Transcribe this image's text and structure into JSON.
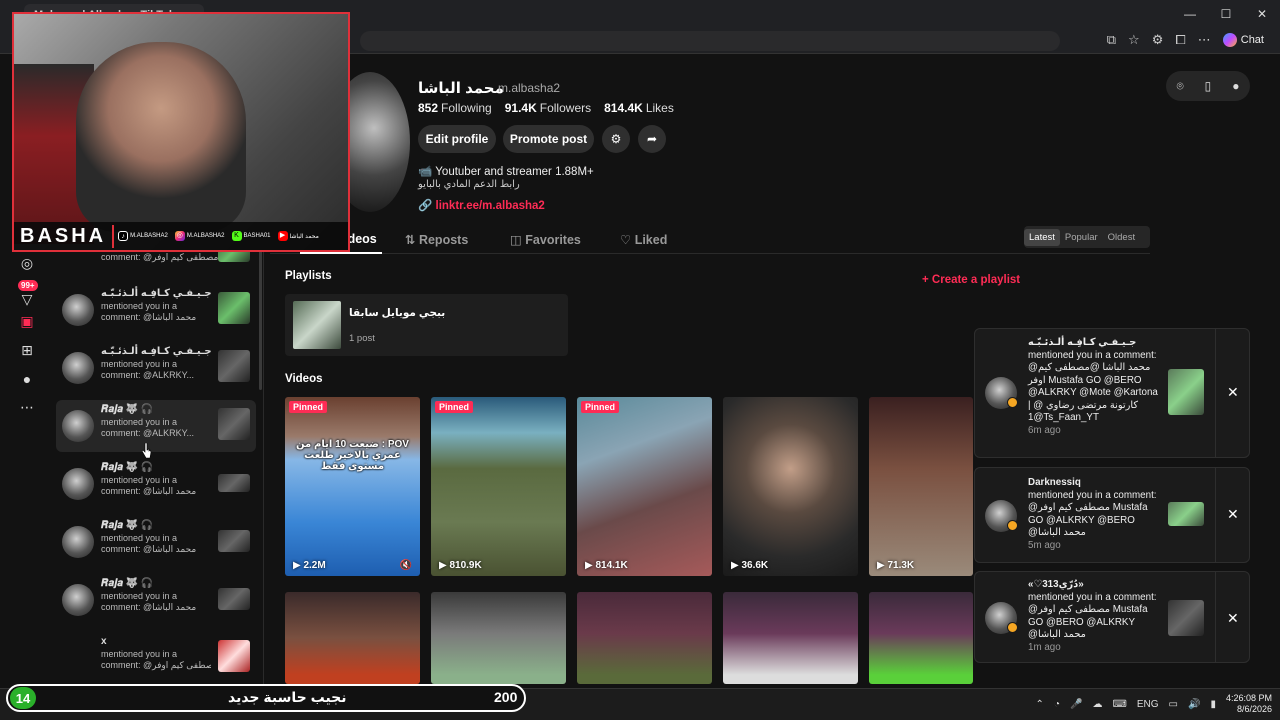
{
  "browser": {
    "tab_title": "Mohamed Albasha · TikTok",
    "chat_label": "Chat"
  },
  "profile": {
    "display_name": "محمد الباشا",
    "username": "m.albasha2",
    "following_count": "852",
    "following_label": "Following",
    "followers_count": "91.4K",
    "followers_label": "Followers",
    "likes_count": "814.4K",
    "likes_label": "Likes",
    "edit_label": "Edit profile",
    "promote_label": "Promote post",
    "bio_line1": "📹 Youtuber and streamer 1.88M+",
    "bio_line2": "رابط الدعم المادي بالبايو",
    "link": "linktr.ee/m.albasha2"
  },
  "tabs": {
    "videos": "Videos",
    "reposts": "Reposts",
    "favorites": "Favorites",
    "liked": "Liked"
  },
  "sort": {
    "latest": "Latest",
    "popular": "Popular",
    "oldest": "Oldest"
  },
  "playlists": {
    "heading": "Playlists",
    "create_label": "+ Create a playlist",
    "item_title": "ببجي موبايل سابقا",
    "item_count": "1 post"
  },
  "videos_heading": "Videos",
  "videos": [
    {
      "pinned": "Pinned",
      "views": "▶ 2.2M",
      "caption": "POV : ضيعت 10 ايام من عمري بالاخير طلعت مستوى فقط"
    },
    {
      "pinned": "Pinned",
      "views": "▶ 810.9K",
      "caption": ""
    },
    {
      "pinned": "Pinned",
      "views": "▶ 814.1K",
      "caption": ""
    },
    {
      "pinned": "",
      "views": "▶ 36.6K",
      "caption": ""
    },
    {
      "pinned": "",
      "views": "▶ 71.3K",
      "caption": ""
    }
  ],
  "notifications": [
    {
      "name": "",
      "line2": "comment: @مصطفى كيم اوفر...",
      "line3": ""
    },
    {
      "name": "جـيـفـي كـافِـه ألـذئـبّـه",
      "line2": "mentioned you in a",
      "line3": "comment: @محمد الباشا"
    },
    {
      "name": "جـيـفـي كـافِـه ألـذئـبّـه",
      "line2": "mentioned you in a",
      "line3": "comment: @ALKRKY..."
    },
    {
      "name": "𝑹𝒂𝒋𝒂 🐺 🎧",
      "line2": "mentioned you in a",
      "line3": "comment: @ALKRKY..."
    },
    {
      "name": "𝑹𝒂𝒋𝒂 🐺 🎧",
      "line2": "mentioned you in a",
      "line3": "comment: @محمد الباشا"
    },
    {
      "name": "𝑹𝒂𝒋𝒂 🐺 🎧",
      "line2": "mentioned you in a",
      "line3": "comment: @محمد الباشا"
    },
    {
      "name": "𝑹𝒂𝒋𝒂 🐺 🎧",
      "line2": "mentioned you in a",
      "line3": "comment: @محمد الباشا"
    },
    {
      "name": "x",
      "line2": "mentioned you in a",
      "line3": "comment: @مصطفى كيم اوفر"
    }
  ],
  "nav": {
    "badge": "99+"
  },
  "popups": [
    {
      "name": "جـيـفـي كـافِـه ألـذئـبّـه",
      "body": "mentioned you in a comment: @محمد الباشا @مصطفى كيم اوفر Mustafa GO @BERO @ALKRKY @Mote @Kartona | كارتونة مرتضى رضاوي @ 1@Ts_Faan_YT",
      "time": "6m ago"
    },
    {
      "name": "Darknessiq",
      "body": "mentioned you in a comment: @مصطفى كيم اوفر Mustafa GO @ALKRKY @BERO @محمد الباشا",
      "time": "5m ago"
    },
    {
      "name": "«♡313دُرّي»",
      "body": "mentioned you in a comment: @مصطفى كيم اوفر Mustafa GO @BERO @ALKRKY @محمد الباشا",
      "time": "1m ago"
    }
  ],
  "webcam": {
    "brand": "BASHA",
    "socials": [
      {
        "icon": "tiktok-icon",
        "label": "M.ALBASHA2"
      },
      {
        "icon": "instagram-icon",
        "label": "M.ALBASHA2"
      },
      {
        "icon": "kick-icon",
        "label": "BASHA01"
      },
      {
        "icon": "youtube-icon",
        "label": "محمد الباشا"
      }
    ]
  },
  "counter": {
    "current": "14",
    "label": "نجيب حاسبة جديد",
    "target": "200"
  },
  "taskbar": {
    "lang": "ENG",
    "time": "4:26:08 PM",
    "date": "8/6/2026"
  },
  "colors": {
    "accent": "#fe2c55",
    "background": "#121212"
  }
}
